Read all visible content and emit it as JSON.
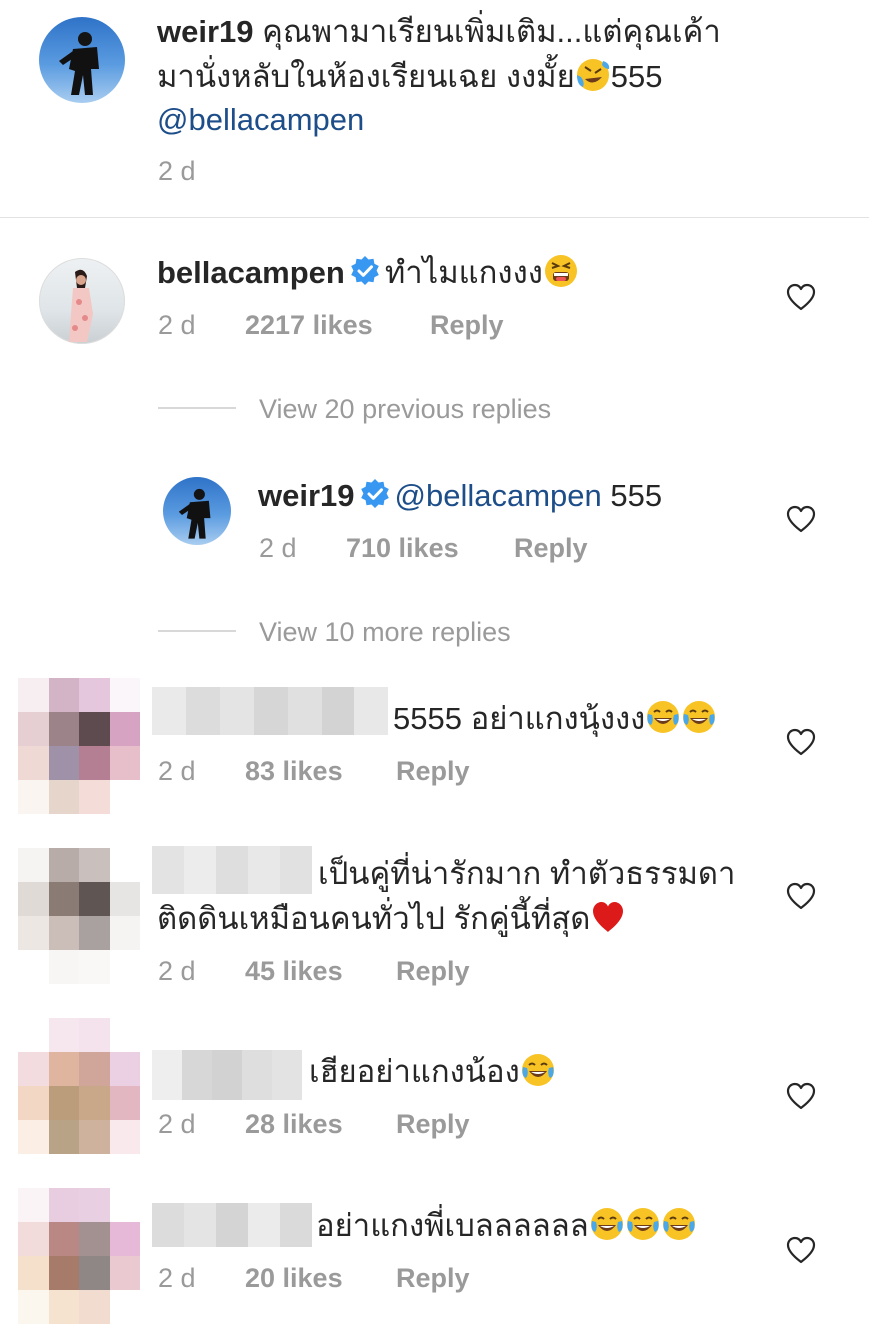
{
  "comments": [
    {
      "username": "weir19",
      "text_line1": "คุณพามาเรียนเพิ่มเติม...แต่คุณเค้า",
      "text_line2_before": "มานั่งหลับในห้องเรียนเฉย งงมั้ย",
      "text_line2_after": "555",
      "mention": "@bellacampen",
      "time": "2 d"
    },
    {
      "username": "bellacampen",
      "text": "ทำไมแกงงง",
      "time": "2 d",
      "likes": "2217 likes",
      "reply": "Reply"
    }
  ],
  "view_previous": "View 20 previous replies",
  "reply_comment": {
    "username": "weir19",
    "mention": "@bellacampen",
    "text": "555",
    "time": "2 d",
    "likes": "710 likes",
    "reply": "Reply"
  },
  "view_more": "View 10 more replies",
  "other_comments": [
    {
      "text": "5555 อย่าแกงนุ้งงง",
      "time": "2 d",
      "likes": "83 likes",
      "reply": "Reply"
    },
    {
      "text_line1": "เป็นคู่ที่น่ารักมาก ทำตัวธรรมดา",
      "text_line2": "ติดดินเหมือนคนทั่วไป รักคู่นี้ที่สุด",
      "time": "2 d",
      "likes": "45 likes",
      "reply": "Reply"
    },
    {
      "text": "เฮียอย่าแกงน้อง",
      "time": "2 d",
      "likes": "28 likes",
      "reply": "Reply"
    },
    {
      "text": "อย่าแกงพี่เบลลลลลล",
      "time": "2 d",
      "likes": "20 likes",
      "reply": "Reply"
    }
  ],
  "icons": {
    "verified": "verified-badge-icon",
    "heart": "heart-outline-icon",
    "rofl_emoji": "rolling-on-floor-laughing",
    "tired_emoji": "tired-face",
    "joy_emoji": "face-with-tears-of-joy",
    "red_heart_emoji": "red-heart"
  },
  "colors": {
    "text": "#262626",
    "meta": "#9a9a9a",
    "mention": "#1d4e89",
    "verified": "#3897f0"
  }
}
